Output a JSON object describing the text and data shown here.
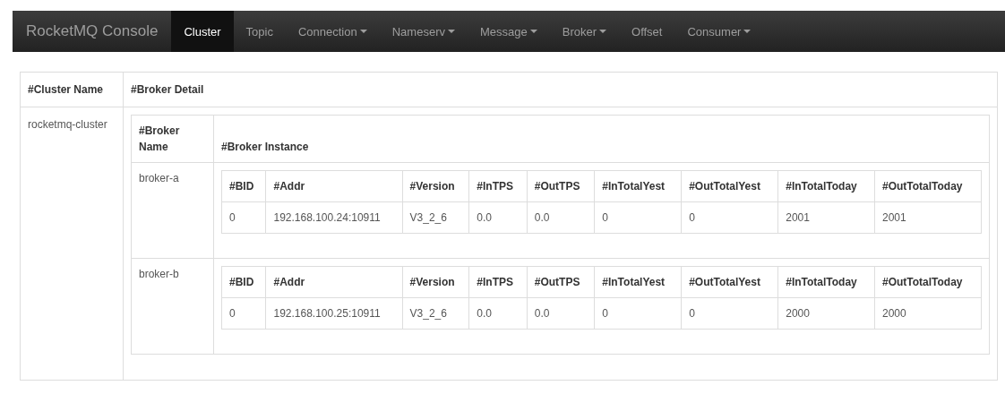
{
  "navbar": {
    "brand": "RocketMQ Console",
    "items": [
      {
        "label": "Cluster",
        "selected": true,
        "dropdown": false
      },
      {
        "label": "Topic",
        "selected": false,
        "dropdown": false
      },
      {
        "label": "Connection",
        "selected": false,
        "dropdown": true
      },
      {
        "label": "Nameserv",
        "selected": false,
        "dropdown": true
      },
      {
        "label": "Message",
        "selected": false,
        "dropdown": true
      },
      {
        "label": "Broker",
        "selected": false,
        "dropdown": true
      },
      {
        "label": "Offset",
        "selected": false,
        "dropdown": false
      },
      {
        "label": "Consumer",
        "selected": false,
        "dropdown": true
      }
    ]
  },
  "table": {
    "columns": [
      "#Cluster Name",
      "#Broker Detail"
    ],
    "rows": [
      {
        "cluster_name": "rocketmq-cluster",
        "broker_columns": [
          "#Broker Name",
          "#Broker Instance"
        ],
        "brokers": [
          {
            "name": "broker-a",
            "instance_columns": [
              "#BID",
              "#Addr",
              "#Version",
              "#InTPS",
              "#OutTPS",
              "#InTotalYest",
              "#OutTotalYest",
              "#InTotalToday",
              "#OutTotalToday"
            ],
            "instances": [
              [
                "0",
                "192.168.100.24:10911",
                "V3_2_6",
                "0.0",
                "0.0",
                "0",
                "0",
                "2001",
                "2001"
              ]
            ]
          },
          {
            "name": "broker-b",
            "instance_columns": [
              "#BID",
              "#Addr",
              "#Version",
              "#InTPS",
              "#OutTPS",
              "#InTotalYest",
              "#OutTotalYest",
              "#InTotalToday",
              "#OutTotalToday"
            ],
            "instances": [
              [
                "0",
                "192.168.100.25:10911",
                "V3_2_6",
                "0.0",
                "0.0",
                "0",
                "0",
                "2000",
                "2000"
              ]
            ]
          }
        ]
      }
    ]
  }
}
